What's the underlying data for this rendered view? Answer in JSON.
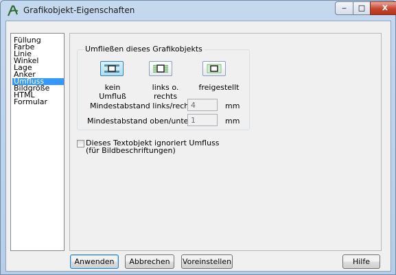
{
  "window": {
    "title": "Grafikobjekt-Eigenschaften",
    "controls": {
      "minimize": "‒",
      "maximize": "□",
      "close": "x"
    }
  },
  "categories": [
    {
      "label": "Füllung",
      "selected": false
    },
    {
      "label": "Farbe",
      "selected": false
    },
    {
      "label": "Linie",
      "selected": false
    },
    {
      "label": "Winkel",
      "selected": false
    },
    {
      "label": "Lage",
      "selected": false
    },
    {
      "label": "Anker",
      "selected": false
    },
    {
      "label": "Umfluss",
      "selected": true
    },
    {
      "label": "Bildgröße",
      "selected": false
    },
    {
      "label": "HTML",
      "selected": false
    },
    {
      "label": "Formular",
      "selected": false
    }
  ],
  "wrap_group": {
    "title": "Umfließen dieses Grafikobjekts",
    "options": [
      {
        "label": "kein Umfluß",
        "icon": "wrap-none-icon",
        "active": true
      },
      {
        "label": "links o. rechts",
        "icon": "wrap-left-right-icon",
        "active": false
      },
      {
        "label": "freigestellt",
        "icon": "wrap-freestanding-icon",
        "active": false
      }
    ],
    "distance_lr": {
      "label": "Mindestabstand links/rechts",
      "value": "4",
      "unit": "mm"
    },
    "distance_tb": {
      "label": "Mindestabstand oben/unten",
      "value": "1",
      "unit": "mm"
    }
  },
  "ignore_wrap": {
    "line1": "Dieses Textobjekt ignoriert Umfluss",
    "line2": "(für Bildbeschriftungen)",
    "checked": false
  },
  "buttons": {
    "apply": "Anwenden",
    "cancel": "Abbrechen",
    "defaults": "Voreinstellen",
    "help": "Hilfe"
  },
  "colors": {
    "selection": "#3399ff",
    "active_button": "#a8dff6",
    "close_button": "#c7442c"
  }
}
